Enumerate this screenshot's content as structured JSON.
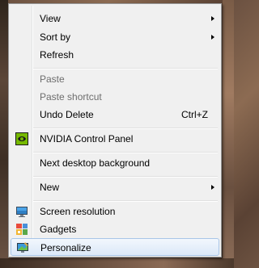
{
  "context_menu": {
    "items": [
      {
        "label": "View",
        "submenu": true
      },
      {
        "label": "Sort by",
        "submenu": true
      },
      {
        "label": "Refresh"
      },
      {
        "label": "Paste",
        "disabled": true
      },
      {
        "label": "Paste shortcut",
        "disabled": true
      },
      {
        "label": "Undo Delete",
        "shortcut": "Ctrl+Z"
      },
      {
        "label": "NVIDIA Control Panel",
        "icon": "nvidia-icon"
      },
      {
        "label": "Next desktop background"
      },
      {
        "label": "New",
        "submenu": true
      },
      {
        "label": "Screen resolution",
        "icon": "screen-resolution-icon"
      },
      {
        "label": "Gadgets",
        "icon": "gadgets-icon"
      },
      {
        "label": "Personalize",
        "icon": "personalize-icon",
        "highlighted": true
      }
    ]
  },
  "colors": {
    "menu_background": "#f0f0f0",
    "highlight": "#dbe8f8",
    "disabled_text": "#6d6d6d"
  }
}
